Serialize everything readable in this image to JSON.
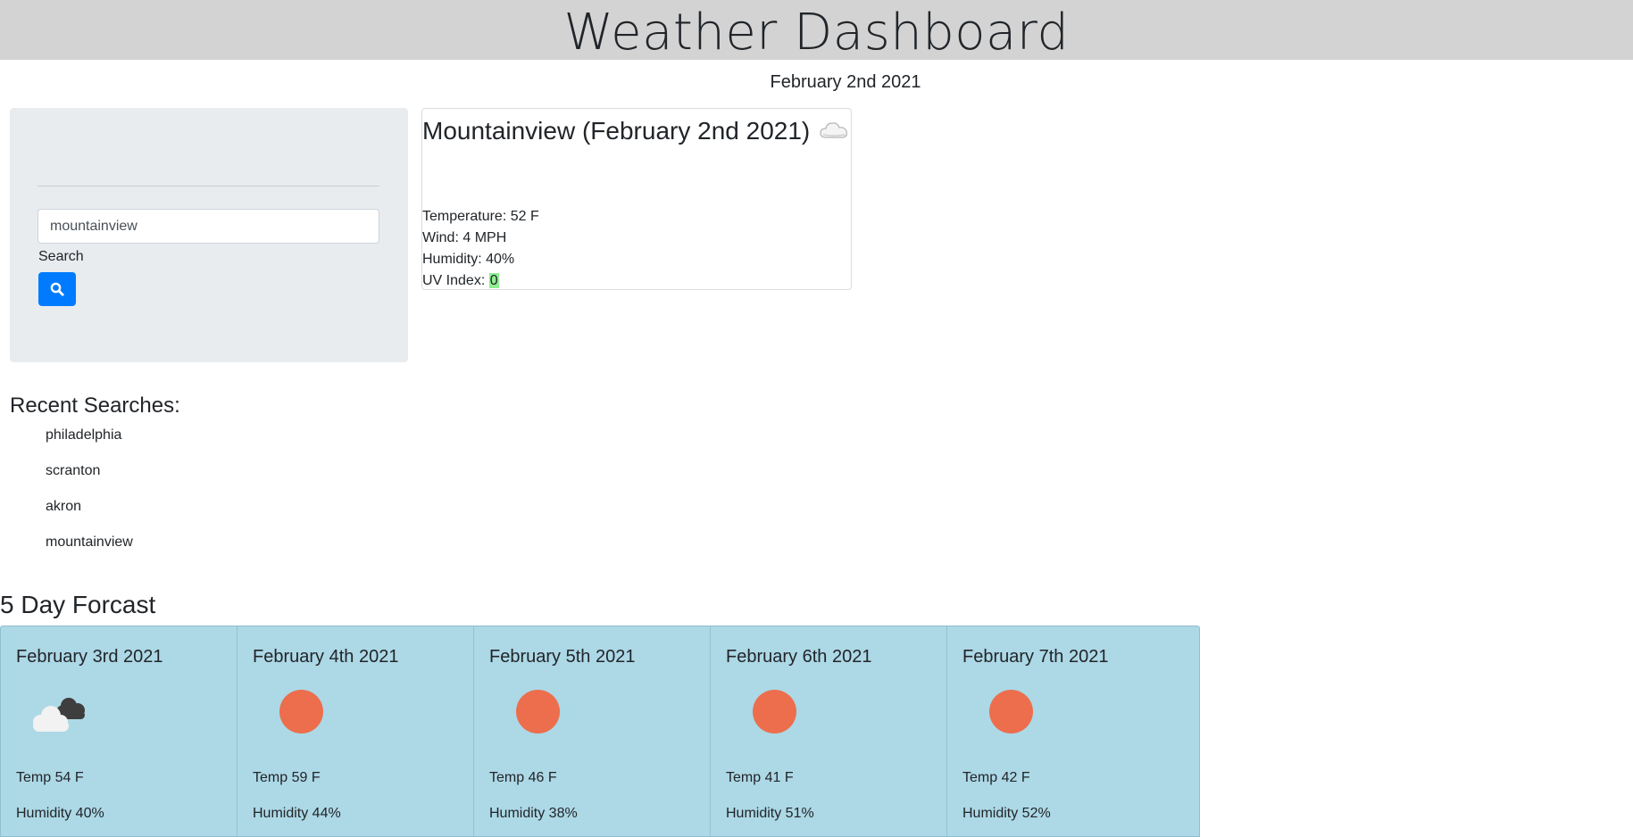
{
  "header": {
    "title": "Weather Dashboard"
  },
  "today_date": "February 2nd 2021",
  "search": {
    "input_value": "mountainview",
    "label": "Search",
    "button_icon": "search-icon",
    "button_color": "#007bff"
  },
  "current": {
    "title": "Mountainview (February 2nd 2021)",
    "icon": "cloud-icon",
    "temperature": "Temperature: 52 F",
    "wind": "Wind: 4 MPH",
    "humidity": "Humidity: 40%",
    "uv_label": "UV Index: ",
    "uv_value": "0",
    "uv_color": "#90ee90"
  },
  "recent": {
    "heading": "Recent Searches:",
    "items": [
      "philadelphia",
      "scranton",
      "akron",
      "mountainview"
    ]
  },
  "forecast": {
    "heading": "5 Day Forcast",
    "days": [
      {
        "date": "February 3rd 2021",
        "icon": "clouds-icon",
        "temp": "Temp 54 F",
        "humidity": "Humidity 40%"
      },
      {
        "date": "February 4th 2021",
        "icon": "sun-icon",
        "temp": "Temp 59 F",
        "humidity": "Humidity 44%"
      },
      {
        "date": "February 5th 2021",
        "icon": "sun-icon",
        "temp": "Temp 46 F",
        "humidity": "Humidity 38%"
      },
      {
        "date": "February 6th 2021",
        "icon": "sun-icon",
        "temp": "Temp 41 F",
        "humidity": "Humidity 51%"
      },
      {
        "date": "February 7th 2021",
        "icon": "sun-icon",
        "temp": "Temp 42 F",
        "humidity": "Humidity 52%"
      }
    ]
  }
}
